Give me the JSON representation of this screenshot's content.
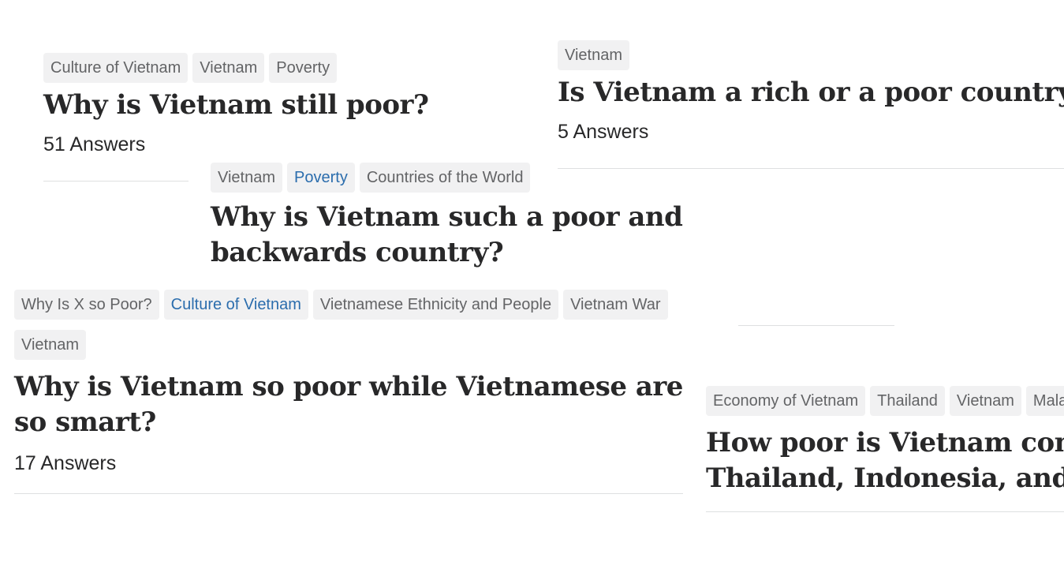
{
  "cards": [
    {
      "tags": [
        "Culture of Vietnam",
        "Vietnam",
        "Poverty"
      ],
      "title": "Why is Vietnam still poor?",
      "answers": "51 Answers"
    },
    {
      "tags": [
        "Vietnam"
      ],
      "title": "Is Vietnam a rich or a poor country?",
      "answers": "5 Answers"
    },
    {
      "tags": [
        "Vietnam",
        "Poverty",
        "Countries of the World"
      ],
      "title": "Why is Vietnam such a poor and backwards country?"
    },
    {
      "tags": [
        "Why Is X so Poor?",
        "Culture of Vietnam",
        "Vietnamese Ethnicity and People",
        "Vietnam War",
        "Vietnam"
      ],
      "title": "Why is Vietnam so poor while Vietnamese are so smart?",
      "answers": "17 Answers"
    },
    {
      "tags": [
        "Economy of Vietnam",
        "Thailand",
        "Vietnam",
        "Malay"
      ],
      "title": "How poor is Vietnam comp",
      "title_line2": "Thailand, Indonesia, and M"
    }
  ],
  "colors": {
    "tag_background": "#f1f1f2",
    "tag_text": "#636466",
    "tag_active_text": "#2b6dad",
    "title_text": "#282829",
    "divider": "#dee0e1"
  }
}
